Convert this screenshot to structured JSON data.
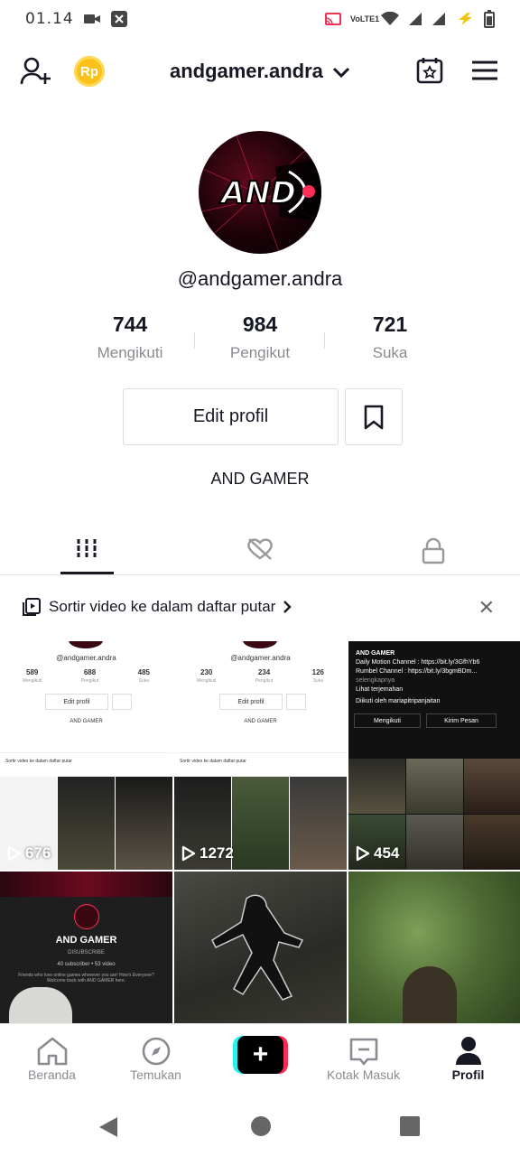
{
  "status_bar": {
    "time": "01.14",
    "network": "VoLTE1"
  },
  "header": {
    "username": "andgamer.andra",
    "coin_label": "Rp"
  },
  "profile": {
    "handle": "@andgamer.andra",
    "stats": [
      {
        "value": "744",
        "label": "Mengikuti"
      },
      {
        "value": "984",
        "label": "Pengikut"
      },
      {
        "value": "721",
        "label": "Suka"
      }
    ],
    "edit_label": "Edit profil",
    "bio": "AND GAMER",
    "avatar_text": "AND"
  },
  "playlist_prompt": "Sortir video ke dalam daftar putar",
  "videos": [
    {
      "views": "676",
      "mini": {
        "handle": "@andgamer.andra",
        "stats": [
          "589",
          "688",
          "485"
        ],
        "labels": [
          "Mengikuti",
          "Pengikut",
          "Suka"
        ],
        "edit": "Edit profil",
        "bio": "AND GAMER",
        "pl": "Sortir video ke dalam daftar putar"
      }
    },
    {
      "views": "1272",
      "mini": {
        "handle": "@andgamer.andra",
        "stats": [
          "230",
          "234",
          "126"
        ],
        "labels": [
          "Mengikuti",
          "Pengikut",
          "Suka"
        ],
        "edit": "Edit profil",
        "bio": "AND GAMER",
        "pl": "Sortir video ke dalam daftar putar"
      }
    },
    {
      "views": "454",
      "dark": {
        "title": "AND GAMER",
        "line1": "Daily Motion Channel : https://bit.ly/3GfhYb6",
        "line2": "Rumbel Channel : https://bit.ly/3bgmBDm...",
        "more": "selengkapnya",
        "translate": "Lihat terjemahan",
        "followed": "Diikuti oleh mariapitripanjaitan",
        "following_btn": "Mengikuti",
        "message_btn": "Kirim Pesan"
      }
    },
    {
      "channel": {
        "name": "AND GAMER",
        "subscribe": "DISUBSCRIBE",
        "meta": "40 subscriber • 53 video",
        "desc": "Friends who love online games wherever you are! How's Everyone? Welcome back with AND GAMER here."
      }
    },
    {},
    {}
  ],
  "bottom_nav": [
    {
      "label": "Beranda",
      "icon": "home-icon"
    },
    {
      "label": "Temukan",
      "icon": "compass-icon"
    },
    {
      "label": "",
      "icon": "plus-icon"
    },
    {
      "label": "Kotak Masuk",
      "icon": "inbox-icon"
    },
    {
      "label": "Profil",
      "icon": "person-icon"
    }
  ]
}
